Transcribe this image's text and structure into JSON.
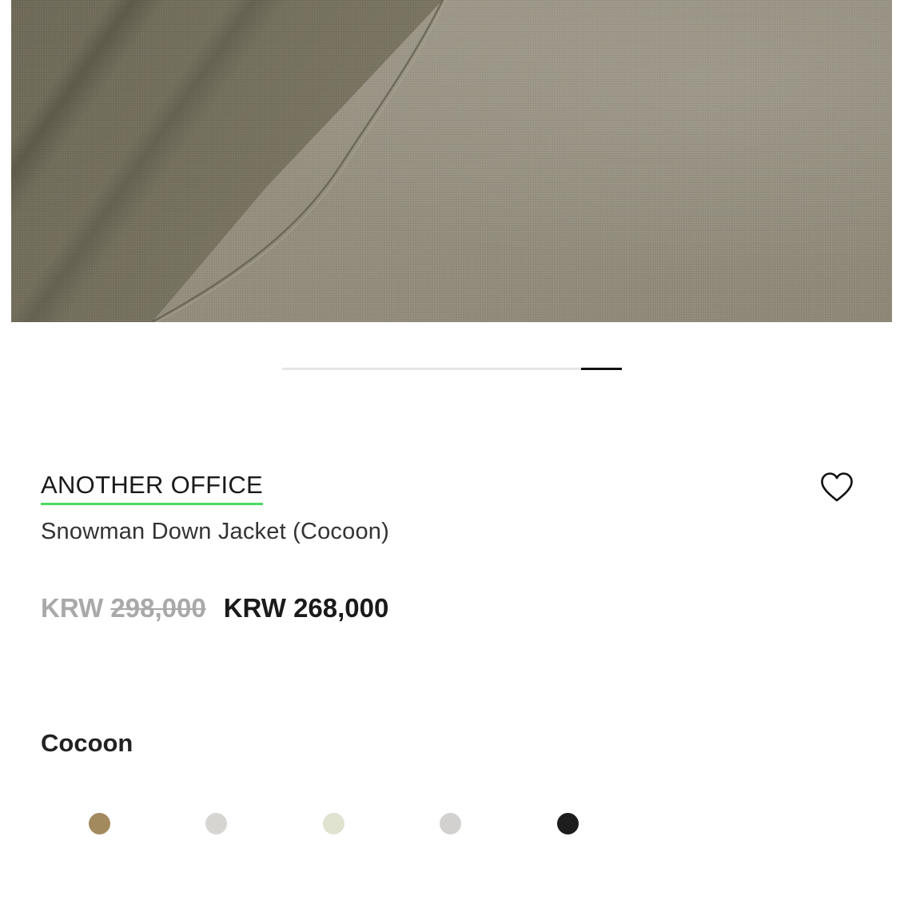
{
  "product": {
    "brand": "ANOTHER OFFICE",
    "name": "Snowman Down Jacket (Cocoon)",
    "original_currency": "KRW",
    "original_amount": "298,000",
    "sale_price": "KRW 268,000",
    "selected_color": "Cocoon"
  },
  "carousel": {
    "progress_fraction": 0.12
  },
  "swatches": [
    {
      "color": "#a38a5e"
    },
    {
      "color": "#d7d5d2"
    },
    {
      "color": "#dfe3cf"
    },
    {
      "color": "#d3d1cf"
    },
    {
      "color": "#1d1d1d"
    }
  ],
  "colors": {
    "brand_underline": "#4cd964",
    "price_strike": "#a9a9a9"
  },
  "icons": {
    "wishlist": "heart-icon"
  }
}
